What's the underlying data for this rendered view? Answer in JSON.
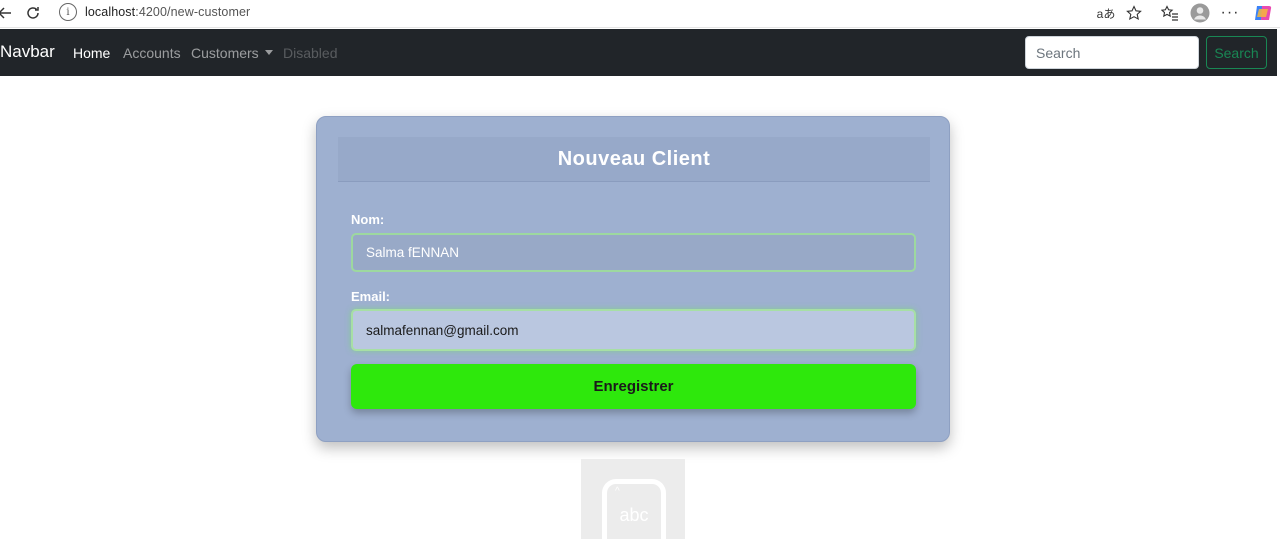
{
  "browser": {
    "url_host": "localhost",
    "url_path": ":4200/new-customer",
    "translate_icon": "aあ"
  },
  "navbar": {
    "brand": "Navbar",
    "links": [
      {
        "label": "Home"
      },
      {
        "label": "Accounts"
      },
      {
        "label": "Customers"
      },
      {
        "label": "Disabled"
      }
    ],
    "search_placeholder": "Search",
    "search_button": "Search"
  },
  "form": {
    "title": "Nouveau Client",
    "name_label": "Nom:",
    "name_value": "Salma fENNAN",
    "email_label": "Email:",
    "email_value": "salmafennan@gmail.com",
    "submit_label": "Enregistrer"
  },
  "ime_widget": {
    "text": "abc"
  },
  "colors": {
    "navbar_bg": "#212529",
    "card_bg": "#9eb0d0",
    "submit_bg": "#2ee80c",
    "search_outline": "#198754"
  }
}
